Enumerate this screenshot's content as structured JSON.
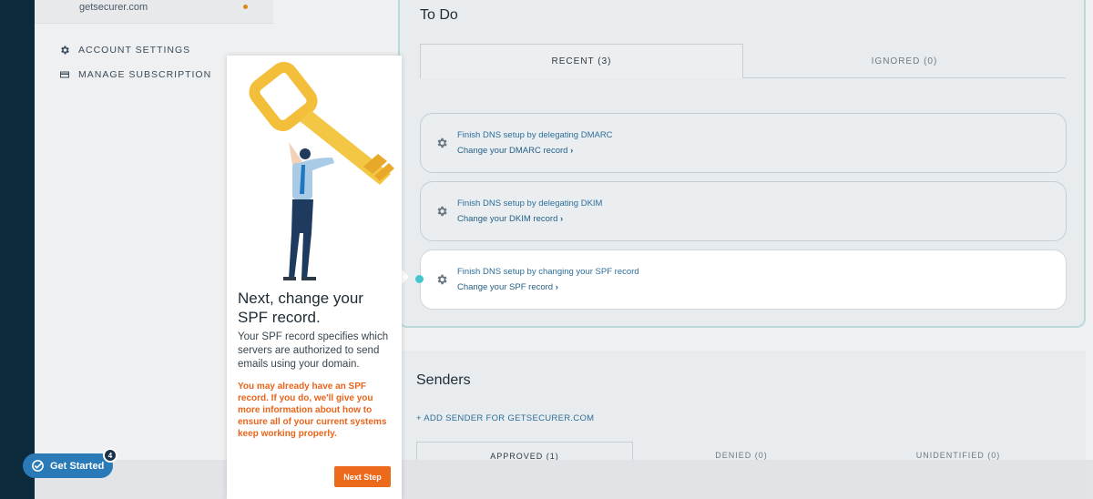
{
  "sidebar": {
    "domain": "getsecurer.com",
    "links": [
      {
        "label": "ACCOUNT SETTINGS",
        "icon": "gear-icon"
      },
      {
        "label": "MANAGE SUBSCRIPTION",
        "icon": "credit-card-icon"
      }
    ]
  },
  "todo": {
    "title": "To Do",
    "tabs": [
      {
        "label": "RECENT (3)",
        "active": true
      },
      {
        "label": "IGNORED (0)",
        "active": false
      }
    ],
    "tasks": [
      {
        "title": "Finish DNS setup by delegating DMARC",
        "link": "Change your DMARC record"
      },
      {
        "title": "Finish DNS setup by delegating DKIM",
        "link": "Change your DKIM record"
      },
      {
        "title": "Finish DNS setup by changing your SPF record",
        "link": "Change your SPF record"
      }
    ]
  },
  "senders": {
    "title": "Senders",
    "add_label": "+ ADD SENDER FOR GETSECURER.COM",
    "tabs": [
      "APPROVED (1)",
      "DENIED (0)",
      "UNIDENTIFIED (0)"
    ]
  },
  "popover": {
    "title": "Next, change your SPF record.",
    "description": "Your SPF record specifies which servers are authorized to send emails using your domain.",
    "warning": "You may already have an SPF record. If you do, we'll give you more information about how to ensure all of your current systems keep working properly.",
    "button": "Next Step"
  },
  "get_started": {
    "label": "Get Started",
    "badge": "4"
  },
  "colors": {
    "rail": "#0b2a3b",
    "accent_orange": "#ec6a1c",
    "link_blue": "#2d6f9a",
    "teal_connector": "#45c6cf",
    "pill_blue": "#2a7ab8"
  }
}
